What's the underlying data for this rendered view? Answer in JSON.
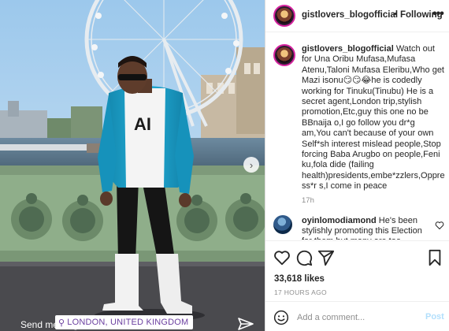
{
  "post": {
    "username": "gistlovers_blogofficial",
    "separator": "•",
    "follow_status": "Following",
    "more_icon": "more-horizontal-icon",
    "caption": "Watch out for Una Oribu Mufasa,Mufasa Atenu,Taloni Mufasa Eleribu,Who get Mazi isonu😏😏😂he is codedly working for Tinuku(Tinubu) He is a secret agent,London trip,stylish promotion,Etc,guy this one no be BBnaija o,I go follow you dr*g am,You can't because of your own Self*sh interest mislead people,Stop forcing Baba Arugbo on people,Feni ku,fola dide (failing health)presidents,embe*zzlers,Oppress*r s,I come in peace",
    "age": "17h",
    "likes": "33,618 likes",
    "posted": "17 HOURS AGO"
  },
  "comment": {
    "username": "oyinlomodiamond",
    "text": "He's been stylishly promoting this Election for them but many are too D.A.F.T to see"
  },
  "photo": {
    "location": "LONDON, UNITED KINGDOM",
    "send_message": "Send message",
    "next_icon": "chevron-right-icon"
  },
  "add_comment": {
    "placeholder": "Add a comment...",
    "post_label": "Post"
  },
  "colors": {
    "accent_link": "#0095f6",
    "post_disabled": "#b2dffc",
    "jacket": "#1aa0c9",
    "sky": "#b9d6ee"
  }
}
